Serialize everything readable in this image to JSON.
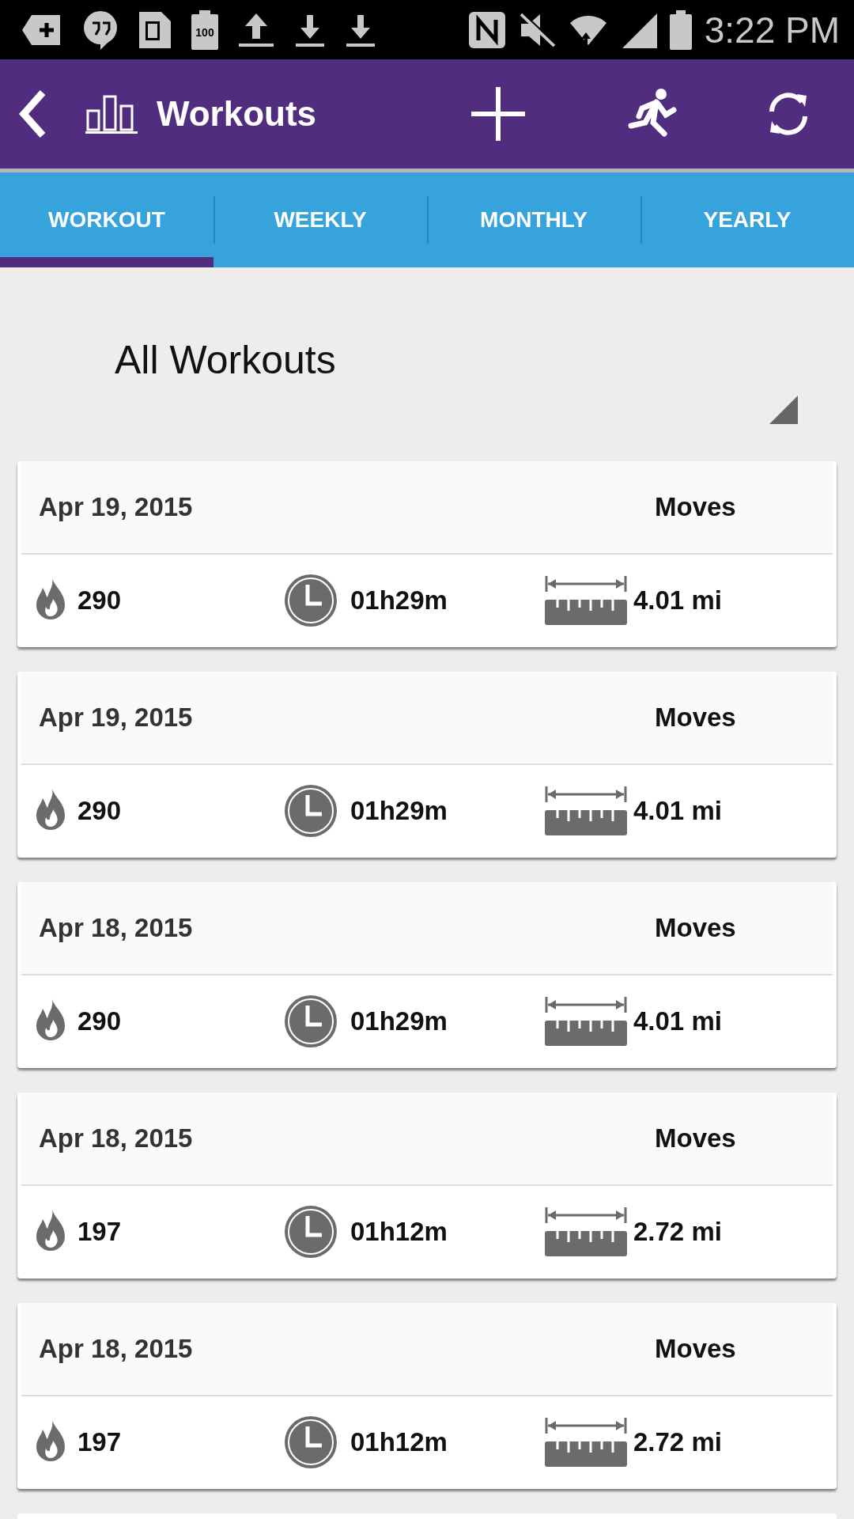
{
  "status_bar": {
    "battery_saver_label": "100",
    "time": "3:22 PM"
  },
  "app_bar": {
    "title": "Workouts"
  },
  "tabs": [
    {
      "label": "WORKOUT",
      "selected": true
    },
    {
      "label": "WEEKLY",
      "selected": false
    },
    {
      "label": "MONTHLY",
      "selected": false
    },
    {
      "label": "YEARLY",
      "selected": false
    }
  ],
  "filter": {
    "value": "All Workouts"
  },
  "workouts": [
    {
      "date": "Apr 19, 2015",
      "source": "Moves",
      "calories": "290",
      "duration": "01h29m",
      "distance": "4.01 mi"
    },
    {
      "date": "Apr 19, 2015",
      "source": "Moves",
      "calories": "290",
      "duration": "01h29m",
      "distance": "4.01 mi"
    },
    {
      "date": "Apr 18, 2015",
      "source": "Moves",
      "calories": "290",
      "duration": "01h29m",
      "distance": "4.01 mi"
    },
    {
      "date": "Apr 18, 2015",
      "source": "Moves",
      "calories": "197",
      "duration": "01h12m",
      "distance": "2.72 mi"
    },
    {
      "date": "Apr 18, 2015",
      "source": "Moves",
      "calories": "197",
      "duration": "01h12m",
      "distance": "2.72 mi"
    }
  ]
}
